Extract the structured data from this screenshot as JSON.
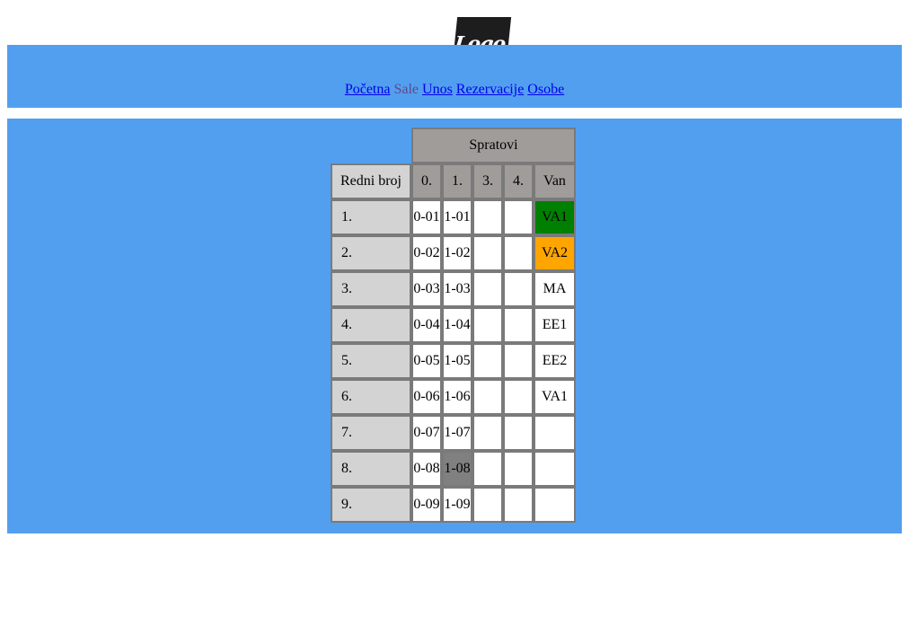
{
  "logo": {
    "text": "Logo",
    "dot": "."
  },
  "nav": {
    "items": [
      {
        "label": "Početna",
        "type": "link"
      },
      {
        "label": "Sale",
        "type": "current"
      },
      {
        "label": "Unos",
        "type": "link"
      },
      {
        "label": "Rezervacije",
        "type": "link"
      },
      {
        "label": "Osobe",
        "type": "link"
      }
    ]
  },
  "table": {
    "group_header": "Spratovi",
    "row_header": "Redni broj",
    "floor_headers": [
      "0.",
      "1.",
      "3.",
      "4.",
      "Van"
    ],
    "rows": [
      {
        "num": "1.",
        "cells": [
          "0-01",
          "1-01",
          "",
          "",
          "VA1"
        ]
      },
      {
        "num": "2.",
        "cells": [
          "0-02",
          "1-02",
          "",
          "",
          "VA2"
        ]
      },
      {
        "num": "3.",
        "cells": [
          "0-03",
          "1-03",
          "",
          "",
          "MA"
        ]
      },
      {
        "num": "4.",
        "cells": [
          "0-04",
          "1-04",
          "",
          "",
          "EE1"
        ]
      },
      {
        "num": "5.",
        "cells": [
          "0-05",
          "1-05",
          "",
          "",
          "EE2"
        ]
      },
      {
        "num": "6.",
        "cells": [
          "0-06",
          "1-06",
          "",
          "",
          "VA1"
        ]
      },
      {
        "num": "7.",
        "cells": [
          "0-07",
          "1-07",
          "",
          "",
          ""
        ]
      },
      {
        "num": "8.",
        "cells": [
          "0-08",
          "1-08",
          "",
          "",
          ""
        ]
      },
      {
        "num": "9.",
        "cells": [
          "0-09",
          "1-09",
          "",
          "",
          ""
        ]
      }
    ],
    "highlights": [
      {
        "row": 0,
        "col": 4,
        "color": "#008000"
      },
      {
        "row": 1,
        "col": 4,
        "color": "#ffa500"
      },
      {
        "row": 7,
        "col": 1,
        "color": "#808080"
      }
    ]
  },
  "colors": {
    "band": "#539fef",
    "header_cell": "#a09c9a",
    "row_header_cell": "#d3d3d3",
    "link": "#0000ee",
    "visited": "#5d4a8f"
  }
}
